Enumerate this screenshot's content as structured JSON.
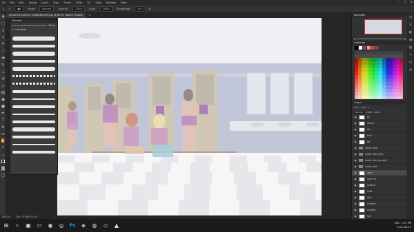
{
  "menu": [
    "File",
    "Edit",
    "Image",
    "Layer",
    "Type",
    "Select",
    "Filter",
    "3D",
    "View",
    "Window",
    "Help"
  ],
  "options": {
    "mode_label": "Mode:",
    "mode_value": "Normal",
    "opacity_label": "Opacity:",
    "opacity_value": "100%",
    "flow_label": "Flow:",
    "flow_value": "100%",
    "smoothing_label": "Smoothing:",
    "smoothing_value": "0%"
  },
  "document_tab": "LOCATION SCHOOL CHANGEROOM.psd @ 66.7% (sketch, RGB/8)",
  "brushes_panel": {
    "title": "Brushes",
    "size_value": "16 px",
    "group_label": "brushes"
  },
  "status": {
    "zoom": "66.67%",
    "doc": "Doc: 25.9M/400.1M"
  },
  "right_panel": {
    "navigator_title": "Navigator",
    "swatches_title": "Swatches",
    "layers_title": "Layers",
    "kind_label": "Kind",
    "blend_value": "Normal",
    "opacity_value": "100%",
    "fill_value": "100%"
  },
  "layers": [
    {
      "name": "fix",
      "type": "layer"
    },
    {
      "name": "sketch",
      "type": "layer"
    },
    {
      "name": "ink",
      "type": "layer"
    },
    {
      "name": "final",
      "type": "layer"
    },
    {
      "name": "bg",
      "type": "layer"
    },
    {
      "name": "locker room",
      "type": "folder"
    },
    {
      "name": "locker door (red)",
      "type": "folder"
    },
    {
      "name": "locker door (purple)",
      "type": "folder"
    },
    {
      "name": "locker door",
      "type": "folder"
    },
    {
      "name": "layer",
      "type": "layer",
      "selected": true
    },
    {
      "name": "layer 16",
      "type": "layer"
    },
    {
      "name": "colored",
      "type": "layer"
    },
    {
      "name": "lines",
      "type": "layer"
    },
    {
      "name": "skin",
      "type": "layer"
    },
    {
      "name": "shadow",
      "type": "layer"
    },
    {
      "name": "shadow",
      "type": "layer"
    },
    {
      "name": "hair",
      "type": "layer"
    },
    {
      "name": "floor",
      "type": "layer"
    }
  ],
  "taskbar": {
    "time": "2:35 PM",
    "date": "2021-08-23",
    "lang": "ENG"
  },
  "colors": {
    "purple": "#7b3d8f",
    "accent": "#e33"
  }
}
